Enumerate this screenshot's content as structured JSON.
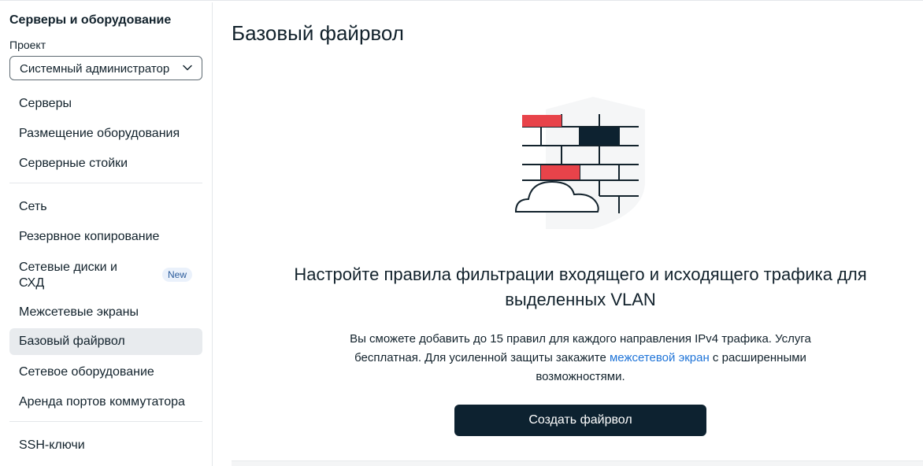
{
  "sidebar": {
    "title": "Серверы и оборудование",
    "project_label": "Проект",
    "project_value": "Системный администратор",
    "items": [
      {
        "label": "Серверы"
      },
      {
        "label": "Размещение оборудования"
      },
      {
        "label": "Серверные стойки"
      },
      {
        "label": "Сеть"
      },
      {
        "label": "Резервное копирование"
      },
      {
        "label": "Сетевые диски и СХД",
        "badge": "New"
      },
      {
        "label": "Межсетевые экраны"
      },
      {
        "label": "Базовый файрвол",
        "active": true
      },
      {
        "label": "Сетевое оборудование"
      },
      {
        "label": "Аренда портов коммутатора"
      },
      {
        "label": "SSH-ключи"
      }
    ]
  },
  "main": {
    "title": "Базовый файрвол",
    "illustration_icon": "firewall-brick-wall-illustration",
    "headline": "Настройте правила фильтрации входящего и исходящего трафика для выделенных VLAN",
    "desc_before": "Вы сможете добавить до 15 правил для каждого направления IPv4 трафика. Услуга бесплатная. Для усиленной защиты закажите ",
    "desc_link": "межсетевой экран",
    "desc_after": " с расширенными возможностями.",
    "cta_label": "Создать файрвол"
  },
  "colors": {
    "accent_dark": "#0d2230",
    "link": "#1f74d8",
    "brick_red": "#e8434a",
    "active_bg": "#e8ebee",
    "badge_bg": "#eaf1fb"
  }
}
